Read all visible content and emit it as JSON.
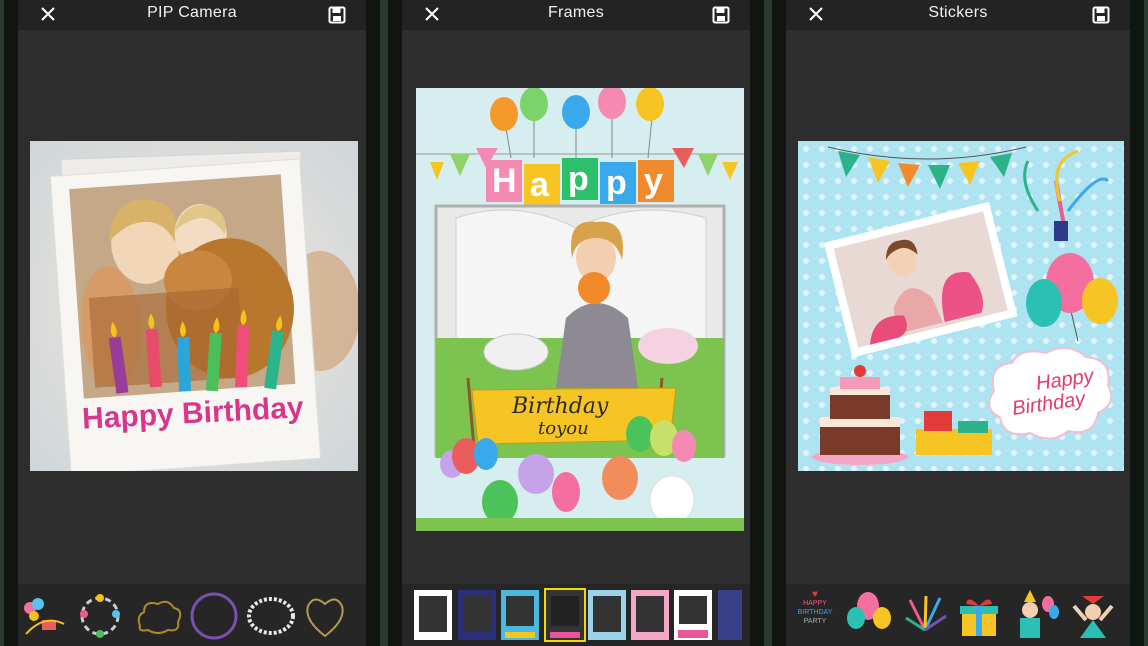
{
  "panels": [
    {
      "title": "PIP Camera"
    },
    {
      "title": "Frames"
    },
    {
      "title": "Stickers"
    }
  ],
  "pip": {
    "greeting": "Happy Birthday"
  },
  "frames": {
    "banner_letters": [
      "H",
      "a",
      "p",
      "p",
      "y"
    ],
    "sign_line1": "Birthday",
    "sign_line2": "toyou"
  },
  "stickers": {
    "cloud_line1": "Happy",
    "cloud_line2": "Birthday",
    "thumb_lines": [
      "HAPPY",
      "BIRTHDAY",
      "PARTY"
    ]
  },
  "colors": {
    "screen_bg": "#2d2d2d",
    "topbar_bg": "#232323",
    "phone_frame": "#0f1511",
    "selected_thumb": "#f5d800",
    "greeting_pink": "#d9368a"
  },
  "icons": [
    "close-icon",
    "save-icon"
  ]
}
